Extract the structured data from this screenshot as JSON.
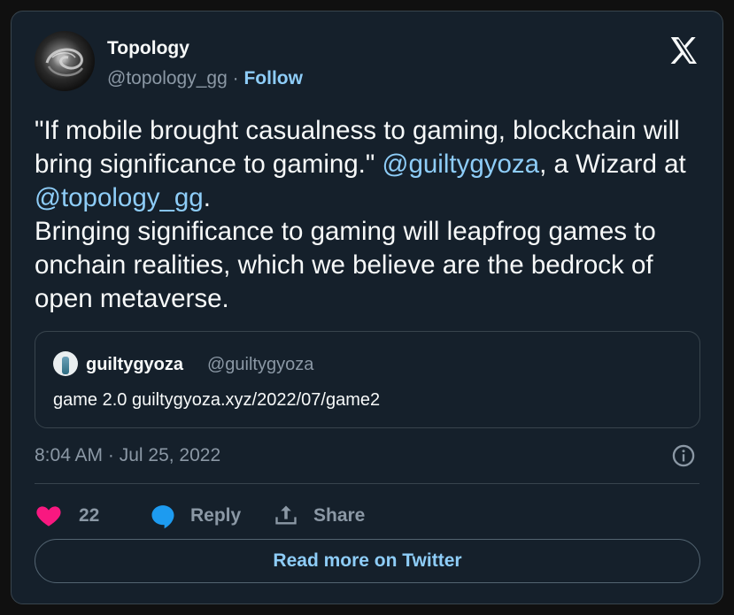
{
  "author": {
    "name": "Topology",
    "handle": "@topology_gg",
    "separator": "·",
    "follow_label": "Follow"
  },
  "tweet": {
    "text_part1": "\"If mobile brought casualness to gaming, blockchain will bring significance to gaming.\" ",
    "mention1": "@guiltygyoza",
    "text_part2": ", a Wizard at ",
    "mention2": "@topology_gg",
    "text_part3": ".\nBringing significance to gaming will leapfrog games to onchain realities, which we believe are the bedrock of open metaverse."
  },
  "quoted": {
    "name": "guiltygyoza",
    "handle": "@guiltygyoza",
    "text": "game 2.0 guiltygyoza.xyz/2022/07/game2"
  },
  "meta": {
    "timestamp": "8:04 AM · Jul 25, 2022"
  },
  "actions": {
    "like_count": "22",
    "reply_label": "Reply",
    "share_label": "Share"
  },
  "read_more_label": "Read more on Twitter",
  "colors": {
    "background": "#15202b",
    "accent": "#8ecdf8",
    "like": "#f91880",
    "reply": "#1d9bf0",
    "muted": "#8b98a5"
  },
  "icons": {
    "logo": "x-logo-icon",
    "like": "heart-icon",
    "reply": "speech-bubble-icon",
    "share": "upload-icon",
    "info": "info-icon"
  }
}
